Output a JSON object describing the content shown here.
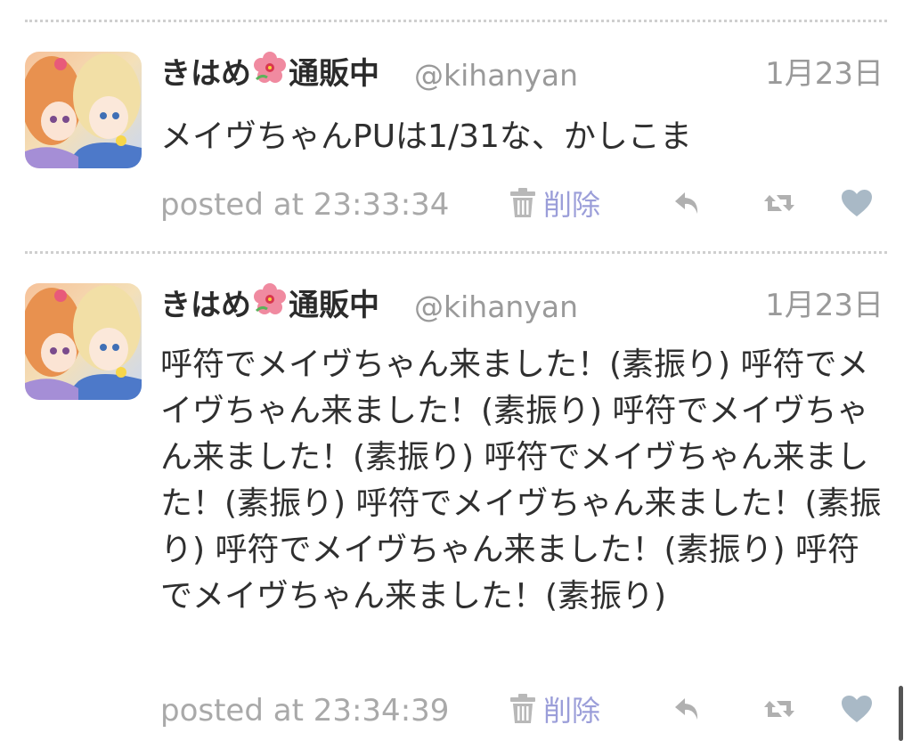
{
  "tweets": [
    {
      "display_name_prefix": "きはめ",
      "display_name_suffix": "通販中",
      "screen_name": "@kihanyan",
      "date": "1月23日",
      "text": "メイヴちゃんPUは1/31な、かしこま",
      "posted": "posted at 23:33:34",
      "delete_label": "削除"
    },
    {
      "display_name_prefix": "きはめ",
      "display_name_suffix": "通販中",
      "screen_name": "@kihanyan",
      "date": "1月23日",
      "text": "呼符でメイヴちゃん来ました！(素振り) 呼符でメイヴちゃん来ました！(素振り) 呼符でメイヴちゃん来ました！(素振り) 呼符でメイヴちゃん来ました！(素振り) 呼符でメイヴちゃん来ました！(素振り) 呼符でメイヴちゃん来ました！(素振り) 呼符でメイヴちゃん来ました！(素振り)",
      "posted": "posted at 23:34:39",
      "delete_label": "削除"
    }
  ],
  "icons": {
    "flower": "hibiscus-emoji",
    "delete": "trash-icon",
    "reply": "reply-icon",
    "retweet": "retweet-icon",
    "favorite": "heart-icon"
  },
  "colors": {
    "delete_link": "#9b9ed9",
    "meta_text": "#9a9a9a",
    "icon": "#b0b0b0",
    "heart": "#a9b9c6",
    "divider": "#cfcfcf"
  }
}
